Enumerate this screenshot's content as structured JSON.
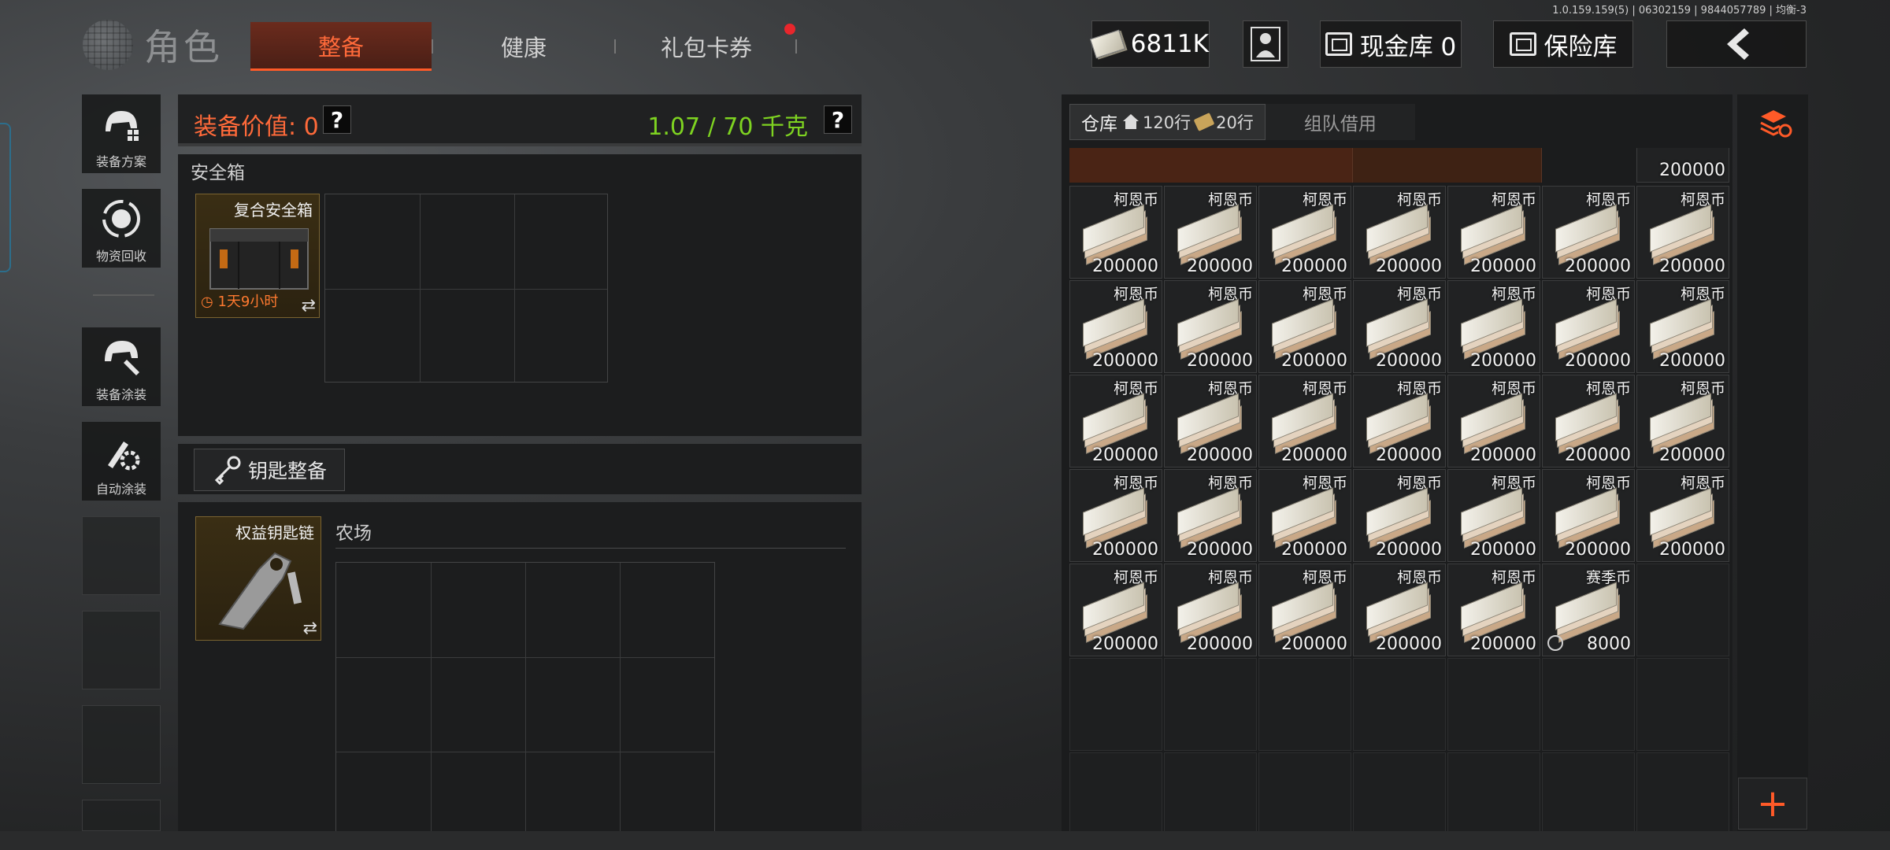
{
  "build_info": "1.0.159.159(5) | 06302159 | 9844057789 | 均衡-3",
  "header": {
    "title": "角色",
    "tabs": [
      {
        "label": "整备",
        "active": true
      },
      {
        "label": "健康",
        "active": false
      },
      {
        "label": "礼包卡券",
        "active": false,
        "has_notification": true
      }
    ],
    "currency": "6811K",
    "cash_vault": "现金库 0",
    "safe_vault": "保险库"
  },
  "left_rail": {
    "items": [
      {
        "label": "装备方案",
        "icon": "helmet-icon"
      },
      {
        "label": "物资回收",
        "icon": "recycle-icon"
      },
      {
        "label": "装备涂装",
        "icon": "paint-helmet-icon"
      },
      {
        "label": "自动涂装",
        "icon": "auto-paint-icon"
      }
    ]
  },
  "equip": {
    "value_label": "装备价值: 0",
    "weight": "1.07 / 70 千克",
    "help": "?"
  },
  "safe_box": {
    "section_label": "安全箱",
    "item_name": "复合安全箱",
    "timer": "1天9小时",
    "swap": "⇄"
  },
  "key": {
    "button_label": "钥匙整备",
    "item_name": "权益钥匙链",
    "swap": "⇄",
    "farm_label": "农场"
  },
  "warehouse": {
    "tab_label": "仓库",
    "rows_main": "120行",
    "rows_ticket": "20行",
    "team_tab": "组队借用",
    "top_partial_amount": "200000",
    "items": [
      {
        "name": "柯恩币",
        "amount": "200000"
      },
      {
        "name": "柯恩币",
        "amount": "200000"
      },
      {
        "name": "柯恩币",
        "amount": "200000"
      },
      {
        "name": "柯恩币",
        "amount": "200000"
      },
      {
        "name": "柯恩币",
        "amount": "200000"
      },
      {
        "name": "柯恩币",
        "amount": "200000"
      },
      {
        "name": "柯恩币",
        "amount": "200000"
      },
      {
        "name": "柯恩币",
        "amount": "200000"
      },
      {
        "name": "柯恩币",
        "amount": "200000"
      },
      {
        "name": "柯恩币",
        "amount": "200000"
      },
      {
        "name": "柯恩币",
        "amount": "200000"
      },
      {
        "name": "柯恩币",
        "amount": "200000"
      },
      {
        "name": "柯恩币",
        "amount": "200000"
      },
      {
        "name": "柯恩币",
        "amount": "200000"
      },
      {
        "name": "柯恩币",
        "amount": "200000"
      },
      {
        "name": "柯恩币",
        "amount": "200000"
      },
      {
        "name": "柯恩币",
        "amount": "200000"
      },
      {
        "name": "柯恩币",
        "amount": "200000"
      },
      {
        "name": "柯恩币",
        "amount": "200000"
      },
      {
        "name": "柯恩币",
        "amount": "200000"
      },
      {
        "name": "柯恩币",
        "amount": "200000"
      },
      {
        "name": "柯恩币",
        "amount": "200000"
      },
      {
        "name": "柯恩币",
        "amount": "200000"
      },
      {
        "name": "柯恩币",
        "amount": "200000"
      },
      {
        "name": "柯恩币",
        "amount": "200000"
      },
      {
        "name": "柯恩币",
        "amount": "200000"
      },
      {
        "name": "柯恩币",
        "amount": "200000"
      },
      {
        "name": "柯恩币",
        "amount": "200000"
      },
      {
        "name": "柯恩币",
        "amount": "200000"
      },
      {
        "name": "柯恩币",
        "amount": "200000"
      },
      {
        "name": "柯恩币",
        "amount": "200000"
      },
      {
        "name": "柯恩币",
        "amount": "200000"
      },
      {
        "name": "柯恩币",
        "amount": "200000"
      },
      {
        "name": "赛季币",
        "amount": "8000",
        "coin": true
      }
    ],
    "add": "+"
  },
  "colors": {
    "accent": "#ff5a28",
    "weight_green": "#7ed321",
    "value_orange": "#ff6a3a"
  }
}
